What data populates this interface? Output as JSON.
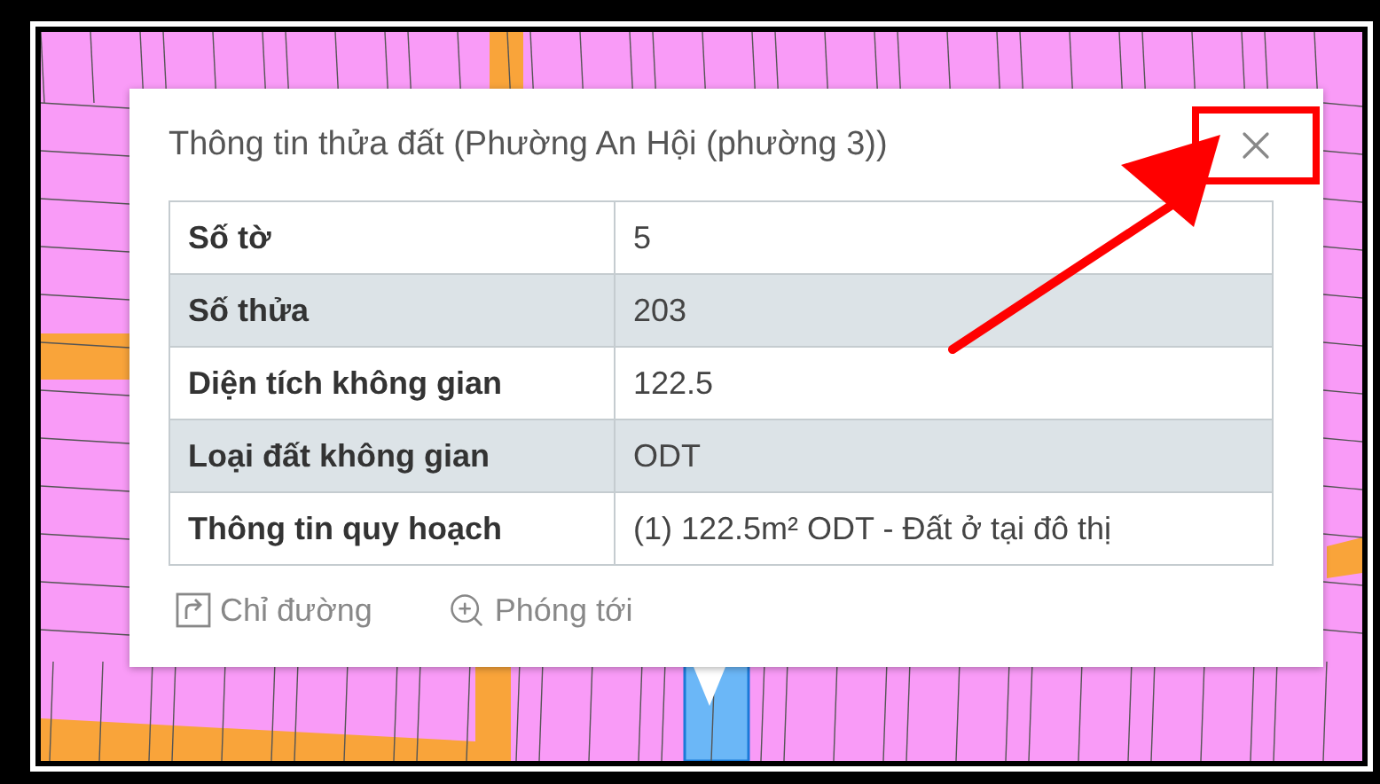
{
  "popup": {
    "title": "Thông tin thửa đất (Phường An Hội (phường 3))",
    "rows": [
      {
        "label": "Số tờ",
        "value": "5"
      },
      {
        "label": "Số thửa",
        "value": "203"
      },
      {
        "label": "Diện tích không gian",
        "value": "122.5"
      },
      {
        "label": "Loại đất không gian",
        "value": "ODT"
      },
      {
        "label": "Thông tin quy hoạch",
        "value": "(1) 122.5m² ODT - Đất ở tại đô thị"
      }
    ],
    "actions": [
      {
        "kind": "directions",
        "label": "Chỉ đường"
      },
      {
        "kind": "zoom",
        "label": "Phóng tới"
      }
    ]
  }
}
